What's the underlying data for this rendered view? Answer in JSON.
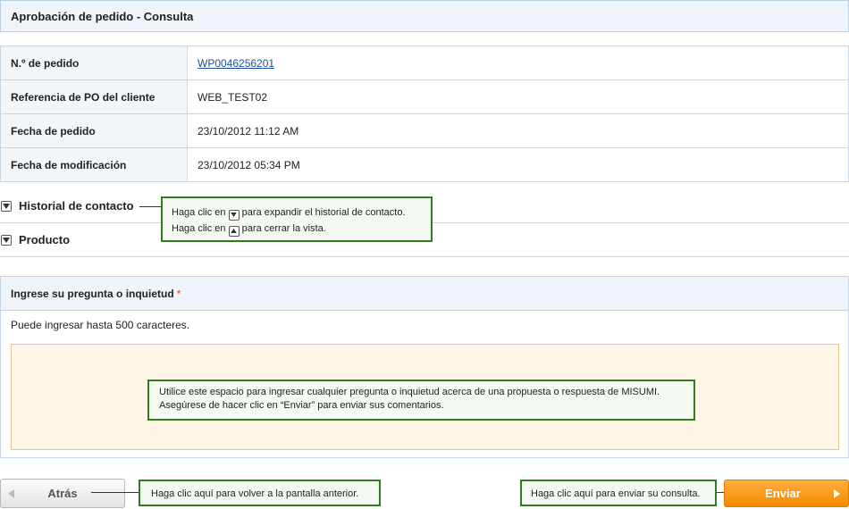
{
  "header": {
    "title": "Aprobación de pedido - Consulta"
  },
  "order_info": {
    "rows": [
      {
        "label": "N.º de pedido",
        "value": "WP0046256201",
        "is_link": true
      },
      {
        "label": "Referencia de PO del cliente",
        "value": "WEB_TEST02"
      },
      {
        "label": "Fecha de pedido",
        "value": "23/10/2012 11:12 AM"
      },
      {
        "label": "Fecha de modificación",
        "value": "23/10/2012 05:34 PM"
      }
    ]
  },
  "sections": {
    "contact_history": "Historial de contacto",
    "product": "Producto"
  },
  "callouts": {
    "expand": {
      "line1_before": "Haga clic en",
      "line1_after": "para expandir el historial de contacto.",
      "line2_before": "Haga clic en",
      "line2_after": "para cerrar la vista."
    },
    "textarea": {
      "line1": "Utilice este espacio para ingresar cualquier pregunta o inquietud acerca de una propuesta o respuesta de MISUMI.",
      "line2": "Asegúrese de hacer clic en “Enviar” para enviar sus comentarios."
    },
    "back": "Haga clic aquí para volver a la pantalla anterior.",
    "submit": "Haga clic aquí para enviar su consulta."
  },
  "inquiry": {
    "label": "Ingrese su pregunta o inquietud",
    "required_mark": "*",
    "hint": "Puede ingresar hasta 500 caracteres.",
    "value": ""
  },
  "buttons": {
    "back_label": "Atrás",
    "submit_label": "Enviar"
  },
  "colors": {
    "accent_orange": "#f28a00",
    "callout_border": "#2f7d1f",
    "header_bg": "#eef4fa",
    "link": "#1a50a0"
  },
  "icons": {
    "toggle": "triangle-down-icon",
    "collapse": "triangle-up-icon",
    "back": "triangle-left-icon",
    "submit": "triangle-right-icon"
  }
}
